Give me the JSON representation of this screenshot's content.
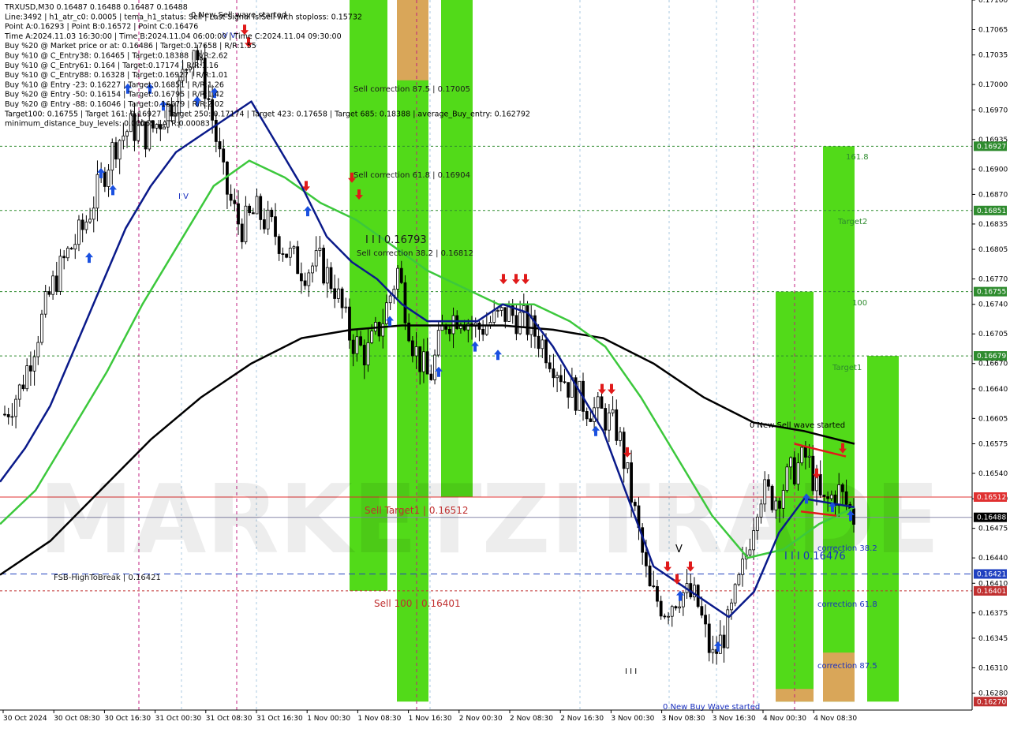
{
  "header": {
    "lines": [
      "TRXUSD,M30  0.16487 0.16488 0.16487 0.16488",
      "Line:3492 | h1_atr_c0: 0.0005 | tema_h1_status: Sell | Last Signal is:Sell with stoploss: 0.15732",
      "Point A:0.16293 | Point B:0.16572 | Point C:0.16476",
      "Time A:2024.11.03 16:30:00 | Time B:2024.11.04 06:00:00 | Time C:2024.11.04 09:30:00",
      "Buy %20 @ Market price or at: 0.16486 | Target:0.17658 | R/R:1.55",
      "Buy %10 @ C_Entry38: 0.16465 | Target:0.18388 | R/R:2.62",
      "Buy %10 @ C_Entry61: 0.164 | Target:0.17174 | R/R:1.16",
      "Buy %10 @ C_Entry88: 0.16328 | Target:0.16927 | R/R:1.01",
      "Buy %10 @ Entry -23: 0.16227 | Target:0.16851 | R/R:1.26",
      "Buy %20 @ Entry -50: 0.16154 | Target:0.16795 | R/R:1.42",
      "Buy %20 @ Entry -88: 0.16046 | Target:0.16679 | R/R:2.02",
      "Target100: 0.16755 | Target 161: 0.16927 | Target 250: 0.17174 | Target 423: 0.17658 | Target 685: 0.18388 | average_Buy_entry: 0.162792",
      "minimum_distance_buy_levels: 0.00065 | ATR:0.00083"
    ]
  },
  "annotations": {
    "new_sell_top": "0 New Sell wave started",
    "new_sell_right": "0 New Sell wave started",
    "new_buy_bottom": "0 New Buy Wave started",
    "sell_corr_875": "Sell correction 87.5 | 0.17005",
    "sell_corr_618": "Sell correction 61.8 | 0.16904",
    "sell_corr_382": "Sell correction 38.2 | 0.16812",
    "level_16793": "I I I 0.16793",
    "level_16476": "I I I 0.16476",
    "sell_target1": "Sell Target1 | 0.16512",
    "sell_100": "Sell 100 | 0.16401",
    "fsb": "FSB-HighToBreak | 0.16421",
    "t1618": "161.8",
    "target2": "Target2",
    "t100": "100",
    "target1": "Target1",
    "corr382": "correction 38.2",
    "corr618": "correction 61.8",
    "corr875": "correction 87.5",
    "wave_v_top": "V",
    "wave_v_top2": "V",
    "wave_iv": "I V",
    "wave_v_mid": "V",
    "wave_iii": "I I I",
    "watermark": "MARKETZITRADE"
  },
  "chart_data": {
    "type": "candlestick",
    "symbol": "TRXUSD",
    "timeframe": "M30",
    "ylim": [
      0.1626,
      0.171
    ],
    "y_ticks": [
      "0.17100",
      "0.17065",
      "0.17035",
      "0.17000",
      "0.16970",
      "0.16935",
      "0.16900",
      "0.16870",
      "0.16835",
      "0.16805",
      "0.16770",
      "0.16740",
      "0.16705",
      "0.16670",
      "0.16640",
      "0.16605",
      "0.16575",
      "0.16540",
      "0.16510",
      "0.16475",
      "0.16440",
      "0.16410",
      "0.16375",
      "0.16345",
      "0.16310",
      "0.16280"
    ],
    "x_ticks": [
      "30 Oct 2024",
      "30 Oct 08:30",
      "30 Oct 16:30",
      "31 Oct 00:30",
      "31 Oct 08:30",
      "31 Oct 16:30",
      "1 Nov 00:30",
      "1 Nov 08:30",
      "1 Nov 16:30",
      "2 Nov 00:30",
      "2 Nov 08:30",
      "2 Nov 16:30",
      "3 Nov 00:30",
      "3 Nov 08:30",
      "3 Nov 16:30",
      "4 Nov 00:30",
      "4 Nov 08:30"
    ],
    "close_path": [
      0.1661,
      0.1664,
      0.167,
      0.1676,
      0.168,
      0.1683,
      0.1688,
      0.1693,
      0.1695,
      0.1694,
      0.1696,
      0.1699,
      0.1705,
      0.1698,
      0.1688,
      0.1683,
      0.1685,
      0.1683,
      0.168,
      0.1678,
      0.1679,
      0.1676,
      0.167,
      0.1668,
      0.1672,
      0.1678,
      0.1669,
      0.1665,
      0.1672,
      0.1673,
      0.1671,
      0.1672,
      0.1673,
      0.1672,
      0.167,
      0.1667,
      0.1664,
      0.1662,
      0.1661,
      0.1659,
      0.165,
      0.164,
      0.1638,
      0.164,
      0.1639,
      0.1632,
      0.1636,
      0.1643,
      0.1652,
      0.1651,
      0.1654,
      0.1656,
      0.165,
      0.1652,
      0.16488
    ],
    "ema_fast": [
      0.1653,
      0.1657,
      0.1662,
      0.1669,
      0.1676,
      0.1683,
      0.1688,
      0.1692,
      0.1694,
      0.1696,
      0.1698,
      0.1693,
      0.1688,
      0.1682,
      0.1679,
      0.1677,
      0.1674,
      0.1672,
      0.1672,
      0.1672,
      0.1674,
      0.1673,
      0.1669,
      0.1664,
      0.1659,
      0.1651,
      0.1643,
      0.1641,
      0.1639,
      0.1637,
      0.164,
      0.1647,
      0.1651,
      0.16505,
      0.165
    ],
    "sma_mid": [
      0.1648,
      0.1652,
      0.1659,
      0.1666,
      0.1674,
      0.1681,
      0.1688,
      0.1691,
      0.1689,
      0.1686,
      0.1684,
      0.1681,
      0.1678,
      0.1676,
      0.1674,
      0.1674,
      0.1672,
      0.1669,
      0.1663,
      0.1656,
      0.1649,
      0.1644,
      0.1645,
      0.1648,
      0.165
    ],
    "sma_slow": [
      0.1642,
      0.1646,
      0.1652,
      0.1658,
      0.1663,
      0.1667,
      0.167,
      0.1671,
      0.16715,
      0.16715,
      0.16715,
      0.1671,
      0.167,
      0.1667,
      0.1663,
      0.166,
      0.1659,
      0.16575
    ],
    "price_labels": [
      {
        "value": "0.16927",
        "color": "#2e8b2e"
      },
      {
        "value": "0.16851",
        "color": "#2e8b2e"
      },
      {
        "value": "0.16755",
        "color": "#2e8b2e"
      },
      {
        "value": "0.16679",
        "color": "#2e8b2e"
      },
      {
        "value": "0.16512",
        "color": "#e03030"
      },
      {
        "value": "0.16488",
        "color": "#000000"
      },
      {
        "value": "0.16421",
        "color": "#2040c0"
      },
      {
        "value": "0.16401",
        "color": "#c03030"
      },
      {
        "value": "0.16270",
        "color": "#c03030"
      }
    ],
    "colors": {
      "green_zone": "#3fd600",
      "orange_zone": "#e8a060",
      "ema_fast": "#0a1a8a",
      "sma_mid": "#3cc83c",
      "sma_slow": "#000000",
      "candle": "#000000",
      "arrow_buy": "#1a50e0",
      "arrow_sell": "#e01a1a"
    }
  }
}
